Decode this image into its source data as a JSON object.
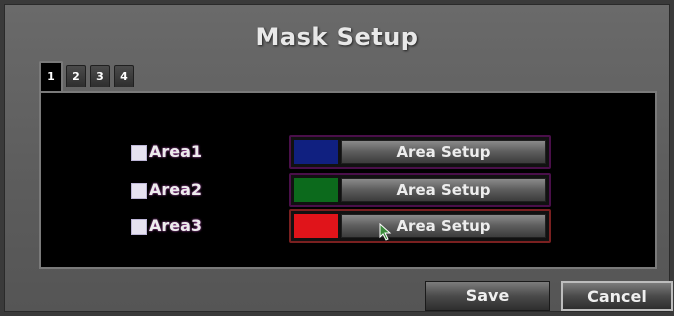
{
  "window": {
    "title": "Mask Setup"
  },
  "tabs": [
    {
      "label": "1",
      "active": true
    },
    {
      "label": "2",
      "active": false
    },
    {
      "label": "3",
      "active": false
    },
    {
      "label": "4",
      "active": false
    }
  ],
  "areas": [
    {
      "label": "Area1",
      "checked": false,
      "color": "#102080",
      "button": "Area Setup"
    },
    {
      "label": "Area2",
      "checked": false,
      "color": "#0c6a1c",
      "button": "Area Setup"
    },
    {
      "label": "Area3",
      "checked": false,
      "color": "#e0141a",
      "button": "Area Setup"
    }
  ],
  "buttons": {
    "save": "Save",
    "cancel": "Cancel"
  }
}
